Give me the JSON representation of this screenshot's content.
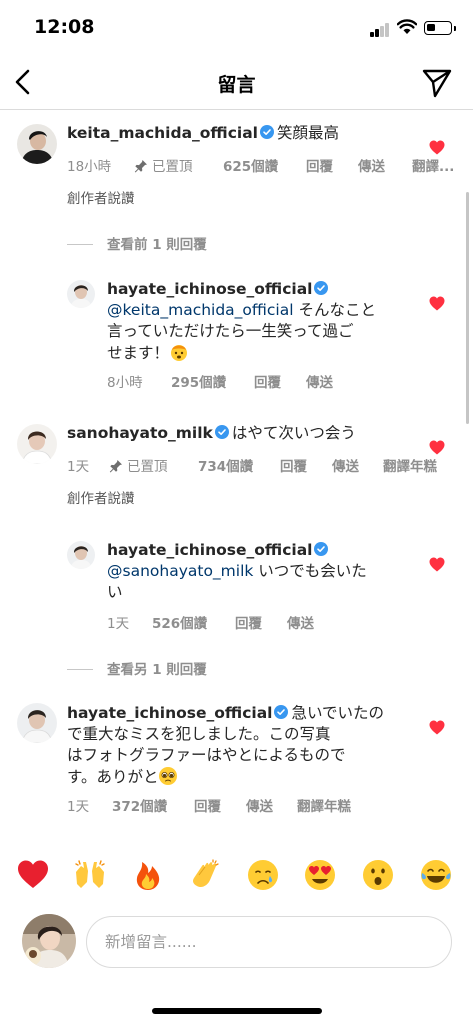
{
  "status_bar": {
    "time": "12:08"
  },
  "header": {
    "title": "留言"
  },
  "comments": [
    {
      "username": "keita_machida_official",
      "text": "笑顔最高",
      "time": "18小時",
      "pinned_label": "已置頂",
      "likes": "625個讚",
      "reply": "回覆",
      "send": "傳送",
      "translate": "翻譯...",
      "creator_liked": "創作者說讚",
      "view_replies": "查看前 1 則回覆",
      "liked": true,
      "replies": [
        {
          "username": "hayate_ichinose_official",
          "mention": "@keita_machida_official",
          "text_line1": " そんなこと",
          "text_line2": "言っていただけたら一生笑って過ご",
          "text_line3": "せます！",
          "emoji": "exploding-head",
          "time": "8小時",
          "likes": "295個讚",
          "reply": "回覆",
          "send": "傳送",
          "liked": true
        }
      ]
    },
    {
      "username": "sanohayato_milk",
      "text": "はやて次いつ会う",
      "time": "1天",
      "pinned_label": "已置頂",
      "likes": "734個讚",
      "reply": "回覆",
      "send": "傳送",
      "translate": "翻譯年糕",
      "creator_liked": "創作者說讚",
      "view_replies": "查看另 1 則回覆",
      "liked": true,
      "replies": [
        {
          "username": "hayate_ichinose_official",
          "mention": "@sanohayato_milk",
          "text_line1": " いつでも会いた",
          "text_line2": "い",
          "time": "1天",
          "likes": "526個讚",
          "reply": "回覆",
          "send": "傳送",
          "liked": true
        }
      ]
    },
    {
      "username": "hayate_ichinose_official",
      "text_line1": "急いでいたの",
      "text_line2": "で重大なミスを犯しました。この写真",
      "text_line3": "はフォトグラファーはやとによるもので",
      "text_line4": "す。ありがと",
      "emoji": "pleading-face",
      "time": "1天",
      "likes": "372個讚",
      "reply": "回覆",
      "send": "傳送",
      "translate": "翻譯年糕",
      "liked": true
    }
  ],
  "reactions": [
    "red-heart",
    "raising-hands",
    "fire",
    "clapping-hands",
    "crying-face",
    "heart-eyes",
    "astonished-face",
    "tears-of-joy"
  ],
  "compose": {
    "placeholder": "新增留言......"
  },
  "colors": {
    "heart": "#ff3040",
    "verified": "#3897f0",
    "meta": "#8e8e8e",
    "mention": "#00376b"
  }
}
